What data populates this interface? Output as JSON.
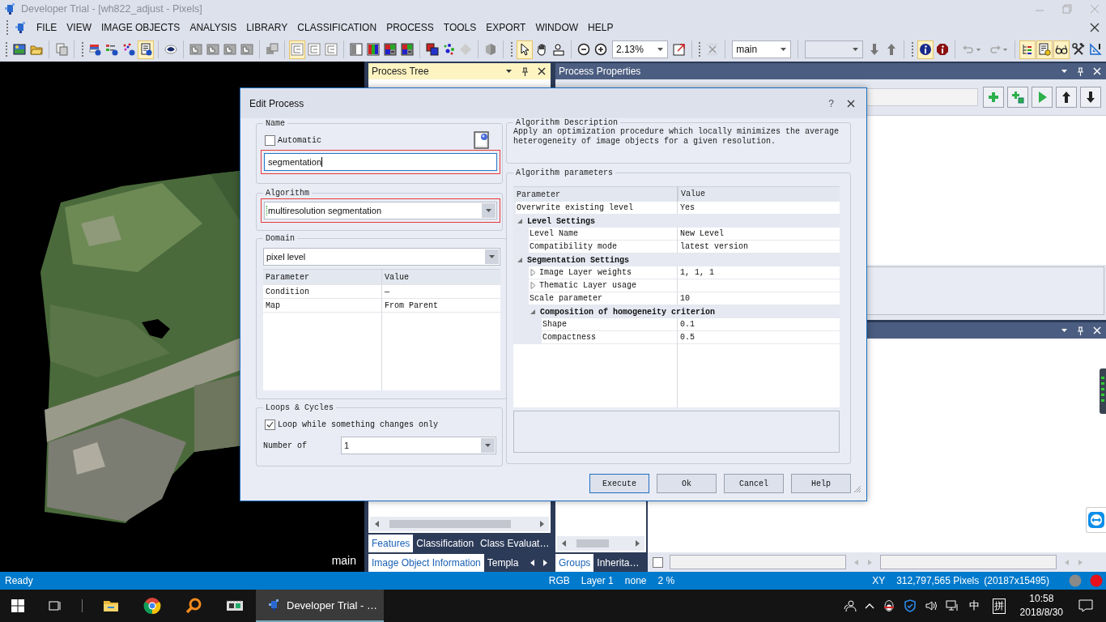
{
  "window": {
    "title": "Developer Trial - [wh822_adjust - Pixels]"
  },
  "menu": [
    "FILE",
    "VIEW",
    "IMAGE OBJECTS",
    "ANALYSIS",
    "LIBRARY",
    "CLASSIFICATION",
    "PROCESS",
    "TOOLS",
    "EXPORT",
    "WINDOW",
    "HELP"
  ],
  "toolbar": {
    "zoom": "2.13%",
    "map": "main",
    "buttons": [
      {
        "pressed": false
      },
      {
        "pressed": false
      },
      {
        "pressed": false
      },
      {
        "pressed": false
      },
      {
        "pressed": false
      },
      {
        "pressed": false
      },
      {
        "pressed": true
      },
      {
        "pressed": false
      },
      {
        "pressed": false
      },
      {
        "pressed": false
      },
      {
        "pressed": false
      },
      {
        "pressed": false
      },
      {
        "pressed": false
      },
      {
        "pressed": true
      },
      {
        "pressed": false
      },
      {
        "pressed": false
      },
      {
        "pressed": false
      },
      {
        "pressed": false
      },
      {
        "pressed": false
      },
      {
        "pressed": false
      },
      {
        "pressed": false
      },
      {
        "pressed": false
      },
      {
        "pressed": false
      },
      {
        "pressed": false
      },
      {
        "pressed": true
      },
      {
        "pressed": false
      },
      {
        "pressed": false
      },
      {
        "pressed": false
      },
      {
        "pressed": false
      },
      {
        "pressed": false
      },
      {
        "pressed": false
      },
      {
        "pressed": false
      },
      {
        "pressed": false
      },
      {
        "pressed": true
      },
      {
        "pressed": false
      },
      {
        "pressed": false
      },
      {
        "pressed": false
      },
      {
        "pressed": true
      },
      {
        "pressed": true
      },
      {
        "pressed": true
      },
      {
        "pressed": false
      },
      {
        "pressed": false
      }
    ]
  },
  "image_view": {
    "map_label": "main"
  },
  "process_tree": {
    "title": "Process Tree",
    "active": true,
    "tabs_top": [
      {
        "label": "Features",
        "selected": true
      },
      {
        "label": "Classification",
        "selected": false
      },
      {
        "label": "Class Evaluat…",
        "selected": false
      }
    ],
    "tabs_bottom": [
      {
        "label": "Image Object Information",
        "selected": true
      },
      {
        "label": "Templa",
        "selected": false
      }
    ]
  },
  "process_properties": {
    "title": "Process Properties",
    "active": false
  },
  "groups_panel": {
    "tabs": [
      {
        "label": "Groups",
        "selected": true
      },
      {
        "label": "Inherita…",
        "selected": false
      }
    ]
  },
  "lower_panel": {
    "active": false,
    "checkbox": {
      "checked": false
    }
  },
  "status_bar": {
    "state": "Ready",
    "items": [
      "RGB",
      "Layer 1",
      "none",
      "2 %"
    ],
    "coords_label": "XY",
    "pixels": "312,797,565 Pixels",
    "size": "(20187x15495)"
  },
  "taskbar": {
    "app": "Developer Trial - …",
    "ime": "中",
    "ime_mode": "拼",
    "time": "10:58",
    "date": "2018/8/30"
  },
  "dialog": {
    "title": "Edit Process",
    "help": "?",
    "name": {
      "legend": "Name",
      "automatic": {
        "label": "Automatic",
        "checked": false
      },
      "value": "segmentation",
      "highlighted": true
    },
    "algorithm": {
      "legend": "Algorithm",
      "value": "multiresolution segmentation",
      "highlighted": true
    },
    "domain": {
      "legend": "Domain",
      "value": "pixel level",
      "columns": [
        "Parameter",
        "Value"
      ],
      "rows": [
        [
          "Condition",
          "—"
        ],
        [
          "Map",
          "From Parent"
        ]
      ]
    },
    "loops": {
      "legend": "Loops & Cycles",
      "loop": {
        "label": "Loop while something changes only",
        "checked": true
      },
      "number_label": "Number of",
      "number": "1"
    },
    "description": {
      "legend": "Algorithm Description",
      "text": "Apply an optimization procedure which locally minimizes the average heterogeneity of image objects for a given resolution."
    },
    "parameters": {
      "legend": "Algorithm parameters",
      "columns": [
        "Parameter",
        "Value"
      ],
      "rows": [
        {
          "kind": "param",
          "name": "Overwrite existing level",
          "value": "Yes"
        },
        {
          "kind": "group",
          "name": "Level Settings",
          "expanded": true,
          "children": [
            {
              "kind": "param",
              "name": "Level Name",
              "value": "New Level"
            },
            {
              "kind": "param",
              "name": "Compatibility mode",
              "value": "latest version"
            }
          ]
        },
        {
          "kind": "group",
          "name": "Segmentation Settings",
          "expanded": true,
          "children": [
            {
              "kind": "param",
              "name": "Image Layer weights",
              "value": "1, 1, 1",
              "expanded": false
            },
            {
              "kind": "param",
              "name": "Thematic Layer usage",
              "expanded": false
            },
            {
              "kind": "param",
              "name": "Scale parameter",
              "value": "10"
            },
            {
              "kind": "group",
              "name": "Composition of homogeneity criterion",
              "expanded": true,
              "children": [
                {
                  "kind": "param",
                  "name": "Shape",
                  "value": "0.1"
                },
                {
                  "kind": "param",
                  "name": "Compactness",
                  "value": "0.5"
                }
              ]
            }
          ]
        }
      ]
    },
    "buttons": [
      {
        "label": "Execute",
        "default": true
      },
      {
        "label": "Ok",
        "default": false
      },
      {
        "label": "Cancel",
        "default": false
      },
      {
        "label": "Help",
        "default": false
      }
    ]
  }
}
